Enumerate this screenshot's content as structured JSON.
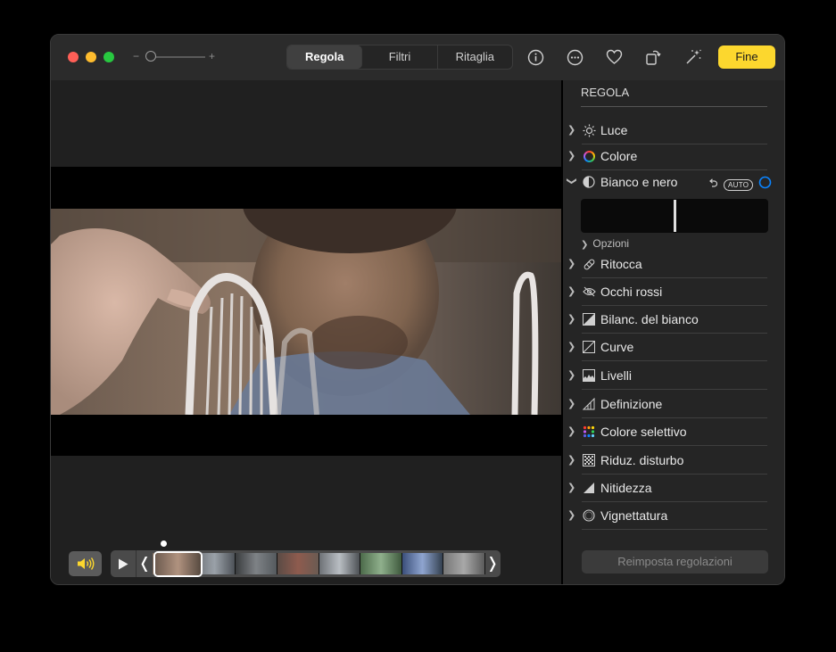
{
  "toolbar": {
    "zoom_minus": "−",
    "zoom_plus": "+",
    "zoom_level": 0.0,
    "tabs": [
      {
        "label": "Regola",
        "active": true
      },
      {
        "label": "Filtri",
        "active": false
      },
      {
        "label": "Ritaglia",
        "active": false
      }
    ],
    "done_label": "Fine",
    "accent_color": "#fcd72e",
    "icons": [
      "info-icon",
      "more-icon",
      "heart-icon",
      "rotate-icon",
      "magic-wand-icon"
    ]
  },
  "player": {
    "open_bracket": "❬",
    "close_bracket": "❭",
    "icons": [
      "speaker-icon",
      "play-icon"
    ]
  },
  "panel": {
    "title": "REGOLA",
    "items": [
      {
        "label": "Luce",
        "icon": "sun-icon",
        "expanded": false
      },
      {
        "label": "Colore",
        "icon": "color-wheel-icon",
        "expanded": false
      },
      {
        "label": "Bianco e nero",
        "icon": "half-circle-icon",
        "expanded": true
      },
      {
        "label": "Ritocca",
        "icon": "bandage-icon",
        "expanded": false
      },
      {
        "label": "Occhi rossi",
        "icon": "eye-slash-icon",
        "expanded": false
      },
      {
        "label": "Bilanc. del bianco",
        "icon": "white-balance-icon",
        "expanded": false
      },
      {
        "label": "Curve",
        "icon": "curves-icon",
        "expanded": false
      },
      {
        "label": "Livelli",
        "icon": "levels-icon",
        "expanded": false
      },
      {
        "label": "Definizione",
        "icon": "definition-icon",
        "expanded": false
      },
      {
        "label": "Colore selettivo",
        "icon": "selective-color-icon",
        "expanded": false
      },
      {
        "label": "Riduz. disturbo",
        "icon": "noise-icon",
        "expanded": false
      },
      {
        "label": "Nitidezza",
        "icon": "sharpness-icon",
        "expanded": false
      },
      {
        "label": "Vignettatura",
        "icon": "vignette-icon",
        "expanded": false
      }
    ],
    "bw_auto": "AUTO",
    "bw_intensity": 0.5,
    "options_label": "Opzioni",
    "reset_label": "Reimposta regolazioni"
  }
}
